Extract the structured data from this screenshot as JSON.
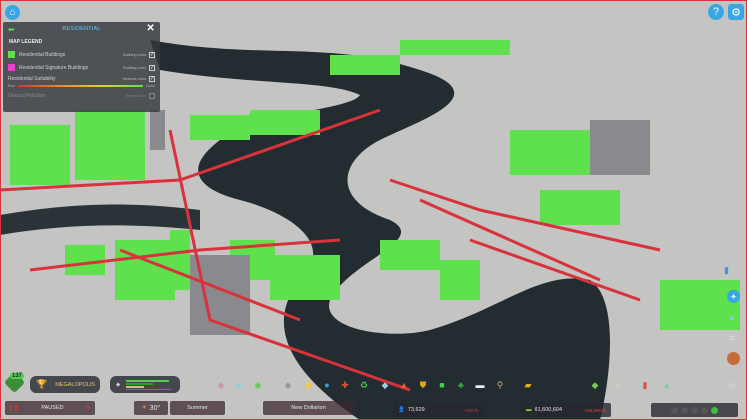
{
  "legend": {
    "header": "RESIDENTIAL",
    "title": "MAP LEGEND",
    "rows": [
      {
        "label": "Residential Buildings",
        "tag": "Building color",
        "checked": true,
        "color": "#5fe04d"
      },
      {
        "label": "Residential Signature Buildings",
        "tag": "Building color",
        "checked": true,
        "color": "#e83fd0"
      },
      {
        "label": "Residential Suitability",
        "tag": "Network color",
        "checked": true
      },
      {
        "label": "Ground Pollution",
        "tag": "Terrain color",
        "checked": false
      }
    ],
    "gradient_low": "Bad",
    "gradient_high": "Good"
  },
  "top_right": {
    "help": "?",
    "settings": "gear-icon"
  },
  "status": {
    "population_badge": "137",
    "milestone": "MEGALOPOLIS",
    "time_state": "PAUSED",
    "temperature": "30°",
    "season": "Summer",
    "city_name": "New Dollarton",
    "population": "73,629",
    "population_change": "-712 /h",
    "money": "¢1,600,604",
    "money_change": "-138,699 /h"
  },
  "colors": {
    "accent": "#37a6e3",
    "residential": "#5fe04d",
    "road": "#d8323c",
    "water": "#1f2a30"
  },
  "toolbar": [
    "zoning",
    "areas",
    "parks",
    "roads",
    "electricity",
    "water",
    "healthcare",
    "garbage",
    "fire",
    "police",
    "transport",
    "parks-recreation",
    "communication",
    "landscaping",
    "bulldozer",
    "economy",
    "map-tiles",
    "statistics",
    "info-views",
    "photo-mode"
  ]
}
